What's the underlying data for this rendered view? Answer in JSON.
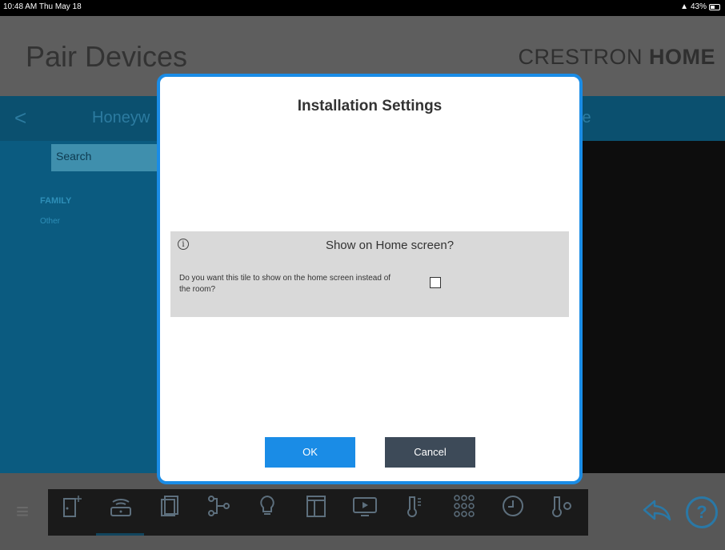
{
  "status_bar": {
    "time": "10:48 AM  Thu May 18",
    "battery": "43%"
  },
  "header": {
    "title": "Pair Devices",
    "brand_light": "CRESTRON",
    "brand_bold": "HOME"
  },
  "panel": {
    "back_glyph": "<",
    "manufacturer_partial": "Honeyw",
    "right_partial": "te",
    "search_placeholder": "Search",
    "family_label": "FAMILY",
    "family_value": "Other"
  },
  "modal": {
    "title": "Installation Settings",
    "section_title": "Show on Home screen?",
    "info_glyph": "i",
    "description": "Do you want this tile to show on the home screen instead of the room?",
    "checkbox_checked": false,
    "ok_label": "OK",
    "cancel_label": "Cancel"
  },
  "toolbar": {
    "menu_glyph": "≡",
    "icons": [
      "door-icon",
      "router-icon",
      "shades-icon",
      "scene-icon",
      "lightbulb-icon",
      "closet-icon",
      "media-icon",
      "thermometer-icon",
      "keypad-icon",
      "clock-icon",
      "thermostat-icon"
    ],
    "share_glyph": "⮪",
    "help_glyph": "?"
  },
  "colors": {
    "accent": "#1a8ce6",
    "panel_blue": "#0b5b80",
    "cancel": "#3d4a58"
  }
}
